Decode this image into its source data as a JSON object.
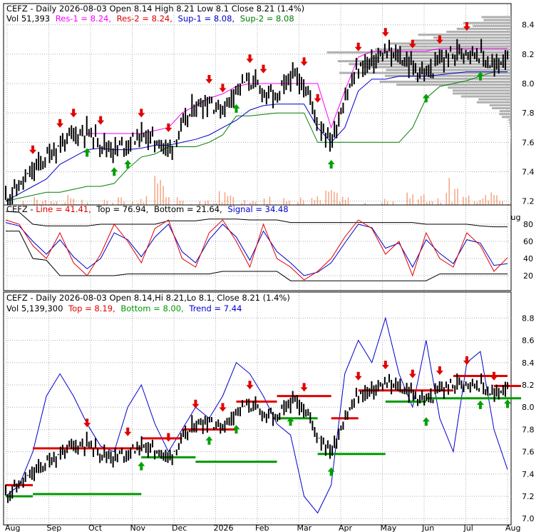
{
  "colors": {
    "up_arrow": "#00a000",
    "down_arrow": "#e00000",
    "res1": "#ff00ff",
    "res2": "#e00000",
    "sup1": "#0000cc",
    "sup2": "#008000",
    "line": "#e00000",
    "signal": "#0000cc",
    "bands": "#000000",
    "volume": "#f4a582",
    "profile": "#b0b0b0",
    "top": "#e00000",
    "bottom": "#009900",
    "trend": "#0000cc",
    "price": "#000000"
  },
  "chart_data": [
    {
      "type": "line",
      "panel": "price",
      "title": {
        "prefix": "CEFZ - Daily 2026-08-03 Open 8.14  High 8.21  Low 8.1  Close 8.21 (1.4%)",
        "line2_vol": "Vol 51,393",
        "res1_label": "Res-1 = 8.24,",
        "res2_label": "Res-2 = 8.24,",
        "sup1_label": "Sup-1 = 8.08,",
        "sup2_label": "Sup-2 = 8.08"
      },
      "x_labels": [
        "Aug",
        "Sep",
        "Oct",
        "Nov",
        "Dec",
        "2026",
        "Feb",
        "Mar",
        "Apr",
        "May",
        "Jun",
        "Jul",
        "Aug"
      ],
      "y_ticks": [
        "7.2",
        "7.4",
        "7.6",
        "7.8",
        "8.0",
        "8.2",
        "8.4"
      ],
      "ylim": [
        7.13,
        8.53
      ],
      "close": [
        7.22,
        7.3,
        7.4,
        7.5,
        7.58,
        7.65,
        7.68,
        7.6,
        7.55,
        7.6,
        7.65,
        7.62,
        7.55,
        7.7,
        7.85,
        7.88,
        7.82,
        7.98,
        8.02,
        7.95,
        7.9,
        8.05,
        8.0,
        7.75,
        7.6,
        7.9,
        8.1,
        8.15,
        8.2,
        8.18,
        8.12,
        8.05,
        8.15,
        8.2,
        8.24,
        8.2,
        8.1,
        8.21
      ],
      "resistance_1": [
        null,
        null,
        null,
        null,
        null,
        null,
        7.66,
        7.66,
        7.66,
        7.66,
        7.66,
        7.68,
        7.7,
        7.8,
        7.85,
        7.9,
        7.93,
        7.98,
        8.0,
        8.0,
        8.0,
        8.0,
        8.0,
        8.0,
        7.7,
        7.95,
        8.18,
        8.22,
        8.22,
        8.22,
        8.22,
        8.22,
        8.24,
        8.24,
        8.24,
        8.24,
        8.24,
        8.24
      ],
      "support_1": [
        7.2,
        7.25,
        7.3,
        7.35,
        7.45,
        7.5,
        7.55,
        7.56,
        7.55,
        7.55,
        7.56,
        7.58,
        7.58,
        7.6,
        7.62,
        7.65,
        7.7,
        7.75,
        7.82,
        7.85,
        7.86,
        7.86,
        7.86,
        7.7,
        7.6,
        7.7,
        7.95,
        8.03,
        8.03,
        8.05,
        8.05,
        8.05,
        8.06,
        8.07,
        8.08,
        8.08,
        8.08,
        8.08
      ],
      "support_2": [
        7.2,
        7.22,
        7.24,
        7.26,
        7.26,
        7.28,
        7.3,
        7.3,
        7.32,
        7.42,
        7.5,
        7.52,
        7.57,
        7.57,
        7.57,
        7.6,
        7.65,
        7.78,
        7.78,
        7.79,
        7.8,
        7.8,
        7.8,
        7.6,
        7.6,
        7.6,
        7.6,
        7.6,
        7.6,
        7.6,
        7.7,
        7.9,
        7.98,
        8.0,
        8.02,
        8.05,
        8.08,
        8.08
      ],
      "volume": [
        0.2,
        0.3,
        0.4,
        0.3,
        0.5,
        0.4,
        0.3,
        0.6,
        0.4,
        0.3,
        0.5,
        1.0,
        0.4,
        0.3,
        0.5,
        0.3,
        0.6,
        0.4,
        0.3,
        0.5,
        0.4,
        0.3,
        0.4,
        0.5,
        0.7,
        0.4,
        0.3,
        0.5,
        0.6,
        0.4,
        0.8,
        0.5,
        0.4,
        0.9,
        0.5,
        0.4,
        0.6,
        0.3
      ],
      "down_arrows": [
        2,
        4,
        5,
        7,
        10,
        12,
        15,
        16,
        18,
        19,
        22,
        23,
        26,
        28,
        30,
        32,
        34
      ],
      "up_arrows": [
        6,
        8,
        9,
        17,
        24,
        31,
        35
      ]
    },
    {
      "type": "line",
      "panel": "oscillator",
      "title": {
        "prefix": "CEFZ - ",
        "line_label": "Line = 41.41,",
        "top_label": "Top = 76.94,",
        "bottom_label": "Bottom = 21.64,",
        "signal_label": "Signal = 34.48"
      },
      "y_ticks": [
        "20",
        "40",
        "60",
        "80"
      ],
      "ylim": [
        5,
        100
      ],
      "line": [
        85,
        80,
        55,
        40,
        70,
        35,
        20,
        45,
        80,
        60,
        35,
        75,
        85,
        40,
        30,
        70,
        85,
        60,
        30,
        80,
        40,
        30,
        15,
        25,
        40,
        65,
        85,
        75,
        45,
        60,
        20,
        70,
        40,
        30,
        70,
        55,
        25,
        41
      ],
      "signal": [
        82,
        78,
        60,
        45,
        62,
        42,
        28,
        40,
        70,
        62,
        42,
        65,
        80,
        48,
        35,
        62,
        80,
        65,
        38,
        72,
        48,
        35,
        20,
        24,
        35,
        58,
        80,
        76,
        52,
        58,
        30,
        62,
        46,
        34,
        62,
        58,
        32,
        34
      ],
      "top_band": [
        95,
        94,
        80,
        78,
        78,
        78,
        78,
        80,
        80,
        80,
        80,
        80,
        84,
        84,
        84,
        86,
        86,
        86,
        85,
        85,
        85,
        82,
        82,
        82,
        82,
        82,
        82,
        82,
        82,
        82,
        82,
        80,
        80,
        80,
        80,
        78,
        77,
        77
      ],
      "bottom_band": [
        72,
        72,
        40,
        38,
        20,
        20,
        20,
        20,
        20,
        22,
        22,
        22,
        22,
        22,
        22,
        22,
        25,
        25,
        25,
        25,
        25,
        14,
        14,
        14,
        14,
        14,
        14,
        14,
        14,
        14,
        14,
        14,
        22,
        22,
        22,
        22,
        22,
        22
      ]
    },
    {
      "type": "line",
      "panel": "trend",
      "title": {
        "prefix": "CEFZ - Daily 2026-08-03 Open 8.14,Hi 8.21,Lo 8.1,  Close 8.21 (1.4%)",
        "line2_vol": "Vol 5,139,300",
        "top_label": "Top = 8.19,",
        "bottom_label": "Bottom = 8.00,",
        "trend_label": "Trend = 7.44"
      },
      "x_labels": [
        "Aug",
        "Sep",
        "Oct",
        "Nov",
        "Dec",
        "2026",
        "Feb",
        "Mar",
        "Apr",
        "May",
        "Jun",
        "Jul",
        "Aug"
      ],
      "y_ticks": [
        "7.0",
        "7.2",
        "7.4",
        "7.6",
        "7.8",
        "8.0",
        "8.2",
        "8.4",
        "8.6",
        "8.8"
      ],
      "ylim": [
        6.95,
        8.95
      ],
      "close": [
        7.22,
        7.3,
        7.4,
        7.5,
        7.58,
        7.65,
        7.68,
        7.6,
        7.55,
        7.6,
        7.65,
        7.62,
        7.55,
        7.7,
        7.85,
        7.88,
        7.82,
        7.98,
        8.02,
        7.95,
        7.9,
        8.05,
        8.0,
        7.75,
        7.6,
        7.9,
        8.1,
        8.15,
        8.2,
        8.18,
        8.12,
        8.05,
        8.15,
        8.2,
        8.24,
        8.2,
        8.1,
        8.21
      ],
      "trend": [
        7.2,
        7.3,
        7.6,
        8.1,
        8.3,
        8.1,
        7.85,
        7.65,
        7.6,
        8.0,
        8.2,
        7.85,
        7.6,
        7.8,
        8.0,
        7.9,
        8.1,
        8.4,
        8.3,
        8.1,
        7.85,
        7.75,
        7.2,
        7.05,
        7.3,
        8.3,
        8.6,
        8.4,
        8.8,
        8.3,
        8.0,
        8.6,
        7.9,
        7.6,
        8.4,
        8.5,
        7.8,
        7.44
      ],
      "top_segments": [
        [
          0,
          2,
          7.3
        ],
        [
          2,
          10,
          7.63
        ],
        [
          10,
          13,
          7.72
        ],
        [
          13,
          17,
          7.8
        ],
        [
          17,
          20,
          8.05
        ],
        [
          20,
          24,
          8.1
        ],
        [
          24,
          26,
          7.9
        ],
        [
          26,
          33,
          8.15
        ],
        [
          33,
          37,
          8.28
        ],
        [
          36,
          38,
          8.19
        ]
      ],
      "bottom_segments": [
        [
          0,
          2,
          7.2
        ],
        [
          2,
          10,
          7.22
        ],
        [
          10,
          14,
          7.55
        ],
        [
          14,
          20,
          7.51
        ],
        [
          20,
          23,
          7.9
        ],
        [
          23,
          28,
          7.58
        ],
        [
          28,
          31,
          8.05
        ],
        [
          31,
          38,
          8.08
        ]
      ],
      "down_arrows": [
        6,
        9,
        12,
        14,
        16,
        18,
        22,
        26,
        28,
        30,
        32,
        34,
        36
      ],
      "up_arrows": [
        10,
        15,
        17,
        21,
        24,
        31,
        35,
        37
      ]
    }
  ]
}
